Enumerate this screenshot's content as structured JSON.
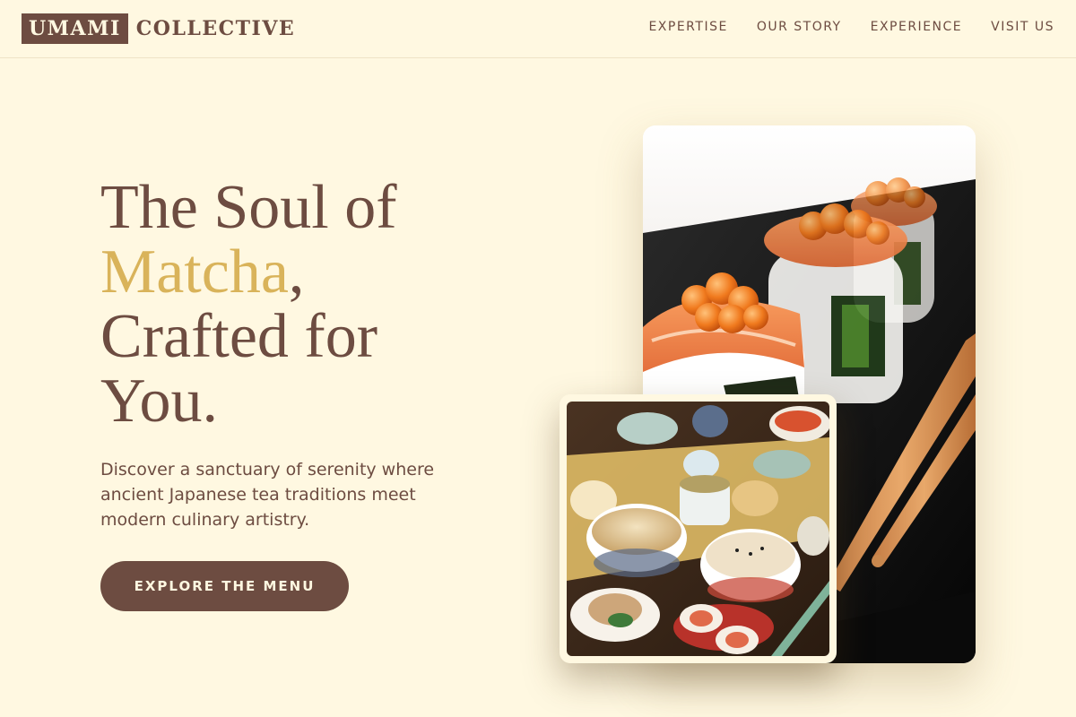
{
  "header": {
    "logo_boxed": "UMAMI",
    "logo_rest": "COLLECTIVE",
    "nav": [
      {
        "label": "EXPERTISE"
      },
      {
        "label": "OUR STORY"
      },
      {
        "label": "EXPERIENCE"
      },
      {
        "label": "VISIT US"
      }
    ]
  },
  "hero": {
    "title_line1": "The Soul of",
    "title_accent": "Matcha",
    "title_comma": ",",
    "title_line3": "Crafted for",
    "title_line4": "You.",
    "subtitle": "Discover a sanctuary of serenity where ancient Japanese tea traditions meet modern culinary artistry.",
    "cta_label": "EXPLORE THE MENU"
  },
  "images": {
    "main_alt": "Salmon sushi rolls topped with salmon roe and chopsticks",
    "secondary_alt": "Japanese set meal with rice bowls, tea cups and small dishes"
  },
  "colors": {
    "background": "#fff8e1",
    "brand_brown": "#6d4c41",
    "accent_gold": "#d9b35a"
  }
}
